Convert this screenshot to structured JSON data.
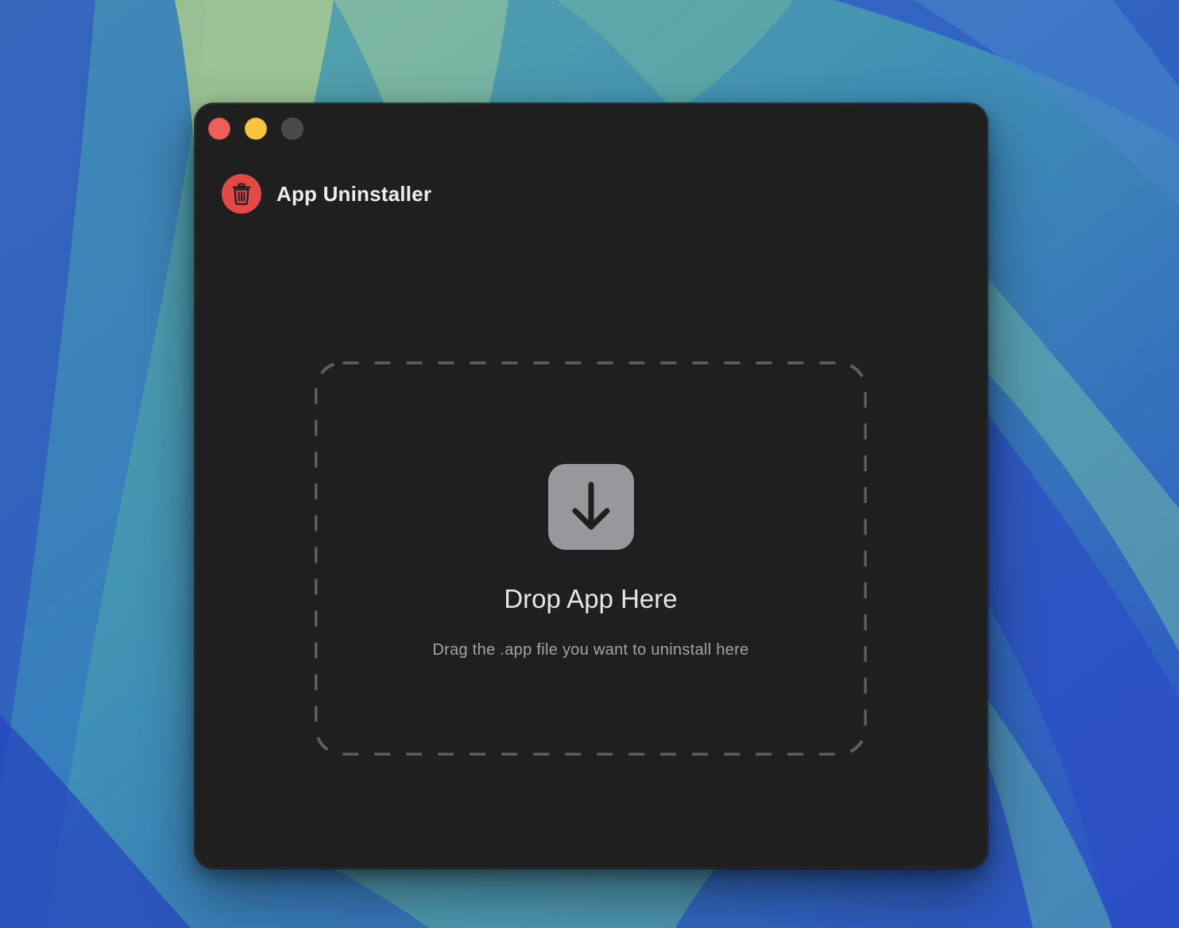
{
  "window": {
    "title": "App Uninstaller",
    "logo_icon": "trash-icon"
  },
  "drop_zone": {
    "icon": "arrow-down-icon",
    "title": "Drop App Here",
    "subtitle": "Drag the .app file you want to uninstall here"
  },
  "colors": {
    "window_background": "#1f1f1f",
    "close_button": "#ee5f5b",
    "minimize_button": "#f5c63d",
    "zoom_button_inactive": "#4a4a4a",
    "logo_background": "#e34a46",
    "drop_icon_background": "#98979c",
    "dashed_border": "#5e5e62"
  }
}
